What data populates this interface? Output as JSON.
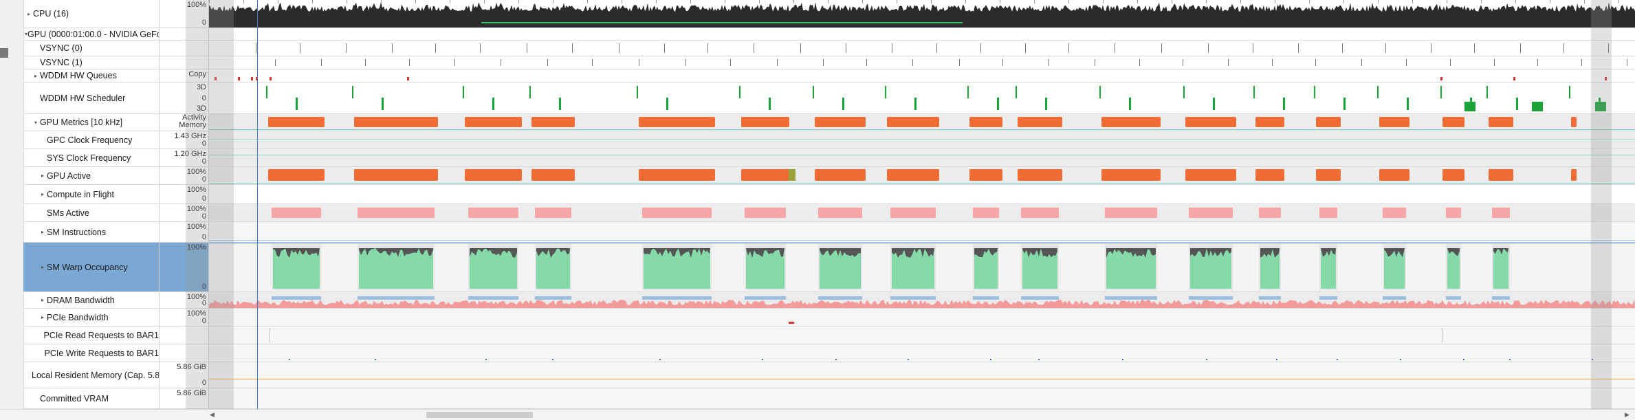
{
  "rows": [
    {
      "id": "cpu",
      "label": "CPU (16)",
      "indent": 0,
      "expander": "collapsed",
      "scale": {
        "top": "100%",
        "bottom": "0"
      }
    },
    {
      "id": "gpu",
      "label": "GPU (0000:01:00.0 - NVIDIA GeFor",
      "indent": 0,
      "expander": "expanded",
      "scale": {}
    },
    {
      "id": "vsync0",
      "label": "VSYNC (0)",
      "indent": 1,
      "expander": "none",
      "scale": {}
    },
    {
      "id": "vsync1",
      "label": "VSYNC (1)",
      "indent": 1,
      "expander": "none",
      "scale": {}
    },
    {
      "id": "wddm_queues",
      "label": "WDDM HW Queues",
      "indent": 1,
      "expander": "collapsed",
      "scale": {
        "top": "Copy"
      }
    },
    {
      "id": "wddm_sched",
      "label": "WDDM HW Scheduler",
      "indent": 1,
      "expander": "none",
      "scale": {
        "top": "3D",
        "mid": "0",
        "bottom": "3D"
      }
    },
    {
      "id": "gpu_metrics",
      "label": "GPU Metrics [10 kHz]",
      "indent": 1,
      "expander": "expanded",
      "scale": {
        "t1": "Activity",
        "t2": "Memory"
      }
    },
    {
      "id": "gpc_clock",
      "label": "GPC Clock Frequency",
      "indent": 2,
      "expander": "none",
      "scale": {
        "top": "1.43 GHz",
        "bottom": "0"
      }
    },
    {
      "id": "sys_clock",
      "label": "SYS Clock Frequency",
      "indent": 2,
      "expander": "none",
      "scale": {
        "top": "1.20 GHz",
        "bottom": "0"
      }
    },
    {
      "id": "gpu_active",
      "label": "GPU Active",
      "indent": 2,
      "expander": "collapsed",
      "scale": {
        "top": "100%",
        "bottom": "0"
      }
    },
    {
      "id": "compute_flight",
      "label": "Compute in Flight",
      "indent": 2,
      "expander": "collapsed",
      "scale": {
        "top": "100%",
        "bottom": "0"
      }
    },
    {
      "id": "sms_active",
      "label": "SMs Active",
      "indent": 2,
      "expander": "none",
      "scale": {
        "top": "100%",
        "bottom": "0"
      }
    },
    {
      "id": "sm_instr",
      "label": "SM Instructions",
      "indent": 2,
      "expander": "collapsed",
      "scale": {
        "top": "100%",
        "bottom": "0"
      }
    },
    {
      "id": "sm_warp",
      "label": "SM Warp Occupancy",
      "indent": 2,
      "expander": "collapsed",
      "selected": true,
      "scale": {
        "top": "100%",
        "bottom": "0"
      }
    },
    {
      "id": "dram_bw",
      "label": "DRAM Bandwidth",
      "indent": 2,
      "expander": "collapsed",
      "scale": {
        "top": "100%",
        "bottom": "0"
      }
    },
    {
      "id": "pcie_bw",
      "label": "PCIe Bandwidth",
      "indent": 2,
      "expander": "collapsed",
      "scale": {
        "top": "100%",
        "bottom": "0"
      }
    },
    {
      "id": "pcie_read",
      "label": "PCIe Read Requests to BAR1",
      "indent": 2,
      "expander": "none",
      "scale": {}
    },
    {
      "id": "pcie_write",
      "label": "PCIe Write Requests to BAR1",
      "indent": 2,
      "expander": "none",
      "scale": {}
    },
    {
      "id": "local_mem",
      "label": "Local Resident Memory (Cap. 5.8",
      "indent": 1,
      "expander": "none",
      "scale": {
        "top": "5.86 GiB",
        "bottom": "0"
      }
    },
    {
      "id": "committed_vram",
      "label": "Committed VRAM",
      "indent": 1,
      "expander": "none",
      "scale": {
        "top": "5.86 GiB"
      }
    }
  ],
  "colors": {
    "cpu_fill": "#2b2b2b",
    "gpu_active": "#ef6c35",
    "sms_active": "#f6a6a6",
    "warp_green": "#86d9a9",
    "warp_dark": "#555555",
    "dram_blue": "#9bbfe0",
    "dram_red": "#f39a9a",
    "sched_green": "#1aa339",
    "queue_red": "#e03030",
    "selected": "#7ba7d3",
    "cursor": "#3a7bd5"
  },
  "icons": {
    "expand": "triangle-right-icon",
    "collapse": "triangle-down-icon",
    "scroll_left": "arrow-left-icon",
    "scroll_right": "arrow-right-icon"
  }
}
